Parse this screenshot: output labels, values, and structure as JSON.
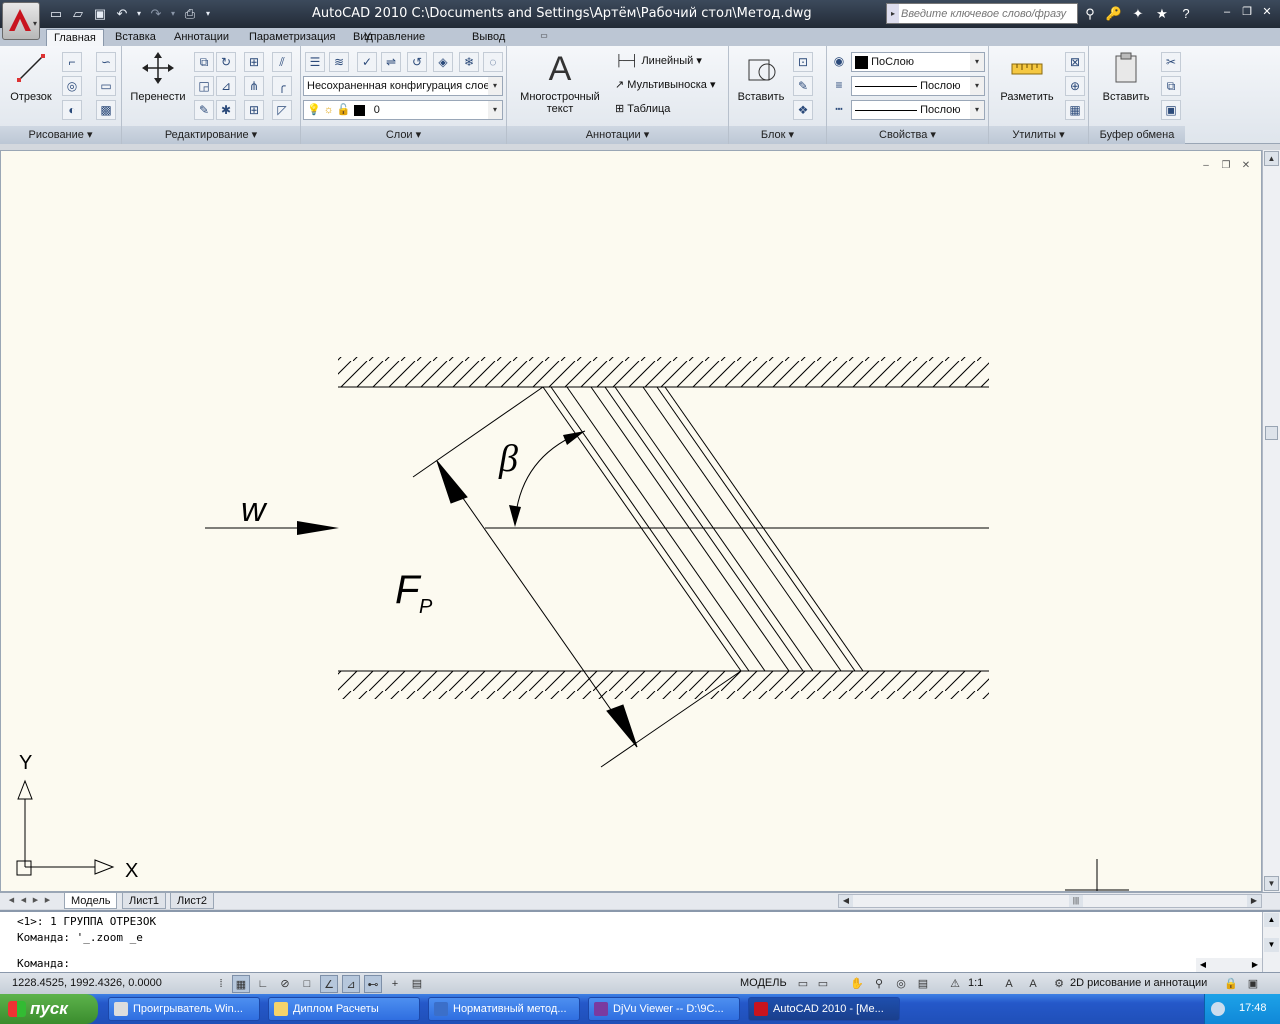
{
  "titlebar": {
    "title": "AutoCAD 2010    C:\\Documents and Settings\\Артём\\Рабочий стол\\Метод.dwg",
    "search_placeholder": "Введите ключевое слово/фразу"
  },
  "ribbon_tabs": [
    "Главная",
    "Вставка",
    "Аннотации",
    "Параметризация",
    "Вид",
    "Управление",
    "Вывод"
  ],
  "panels": {
    "draw": {
      "title": "Рисование",
      "line_label": "Отрезок"
    },
    "modify": {
      "title": "Редактирование",
      "move_label": "Перенести"
    },
    "layers": {
      "title": "Слои",
      "layer_state": "Несохраненная конфигурация слоев",
      "current_layer": "0"
    },
    "annotation": {
      "title": "Аннотации",
      "mtext_label_1": "Многострочный",
      "mtext_label_2": "текст",
      "linear": "Линейный",
      "multileader": "Мультивыноска",
      "table": "Таблица"
    },
    "block": {
      "title": "Блок",
      "insert_label": "Вставить"
    },
    "properties": {
      "title": "Свойства",
      "color": "ПоСлою",
      "linetype": "Послою",
      "lineweight": "Послою"
    },
    "utilities": {
      "title": "Утилиты",
      "measure_label": "Разметить"
    },
    "clipboard": {
      "title": "Буфер обмена",
      "paste_label": "Вставить"
    }
  },
  "drawing": {
    "label_w": "w",
    "label_beta": "β",
    "label_F": "F",
    "label_F_sub": "P",
    "ucs_x": "X",
    "ucs_y": "Y"
  },
  "layout_tabs": [
    "Модель",
    "Лист1",
    "Лист2"
  ],
  "command_lines": [
    "<1>: 1 ГРУППА ОТРЕЗОК",
    "Команда: '_.zoom _e",
    "Команда:"
  ],
  "status": {
    "coords": "1228.4525, 1992.4326, 0.0000",
    "model": "МОДЕЛЬ",
    "scale": "1:1",
    "workspace": "2D рисование и аннотации"
  },
  "taskbar": {
    "start": "пуск",
    "tasks": [
      "Проигрыватель Win...",
      "Диплом Расчеты",
      "Нормативный метод...",
      "DjVu Viewer -- D:\\9C...",
      "AutoCAD 2010 - [Ме..."
    ],
    "clock": "17:48"
  },
  "colors": {
    "canvas": "#fcfaf0",
    "titlebar": "#2c3644",
    "accent_red": "#c8141e"
  }
}
